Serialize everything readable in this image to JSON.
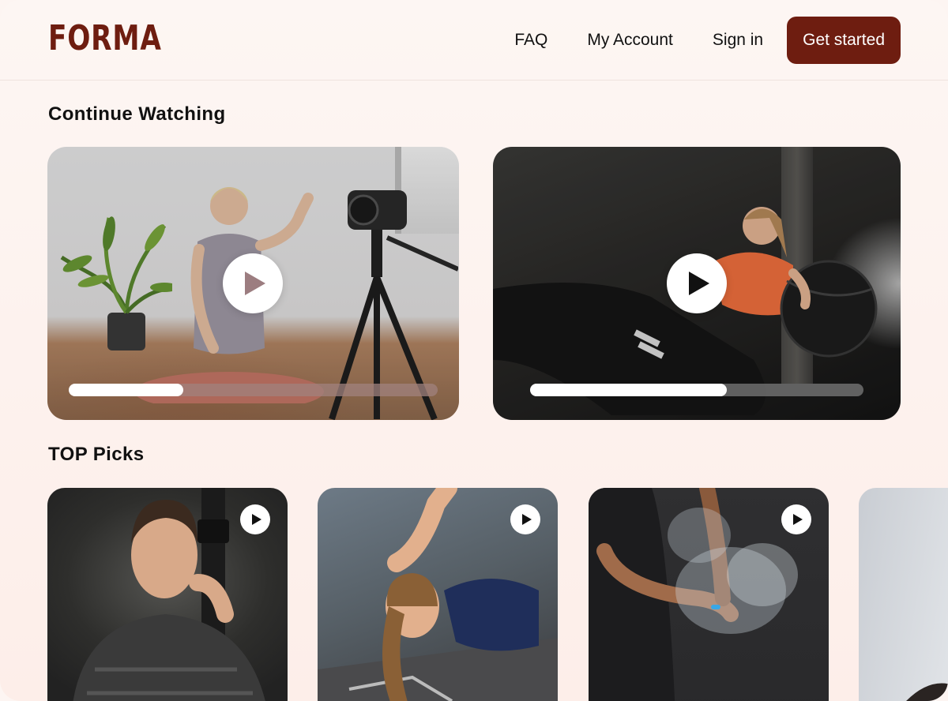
{
  "brand": {
    "logo_text": "FORMA",
    "accent_color": "#6e1d10"
  },
  "nav": {
    "items": [
      "FAQ",
      "My Account",
      "Sign in"
    ],
    "cta_label": "Get started"
  },
  "continue_watching": {
    "title": "Continue Watching",
    "videos": [
      {
        "icon": "play-icon",
        "progress": 0.31
      },
      {
        "icon": "play-icon",
        "progress": 0.59
      }
    ]
  },
  "top_picks": {
    "title": "TOP Picks",
    "videos": [
      {
        "icon": "play-icon"
      },
      {
        "icon": "play-icon"
      },
      {
        "icon": "play-icon"
      },
      {
        "icon": ""
      }
    ]
  }
}
